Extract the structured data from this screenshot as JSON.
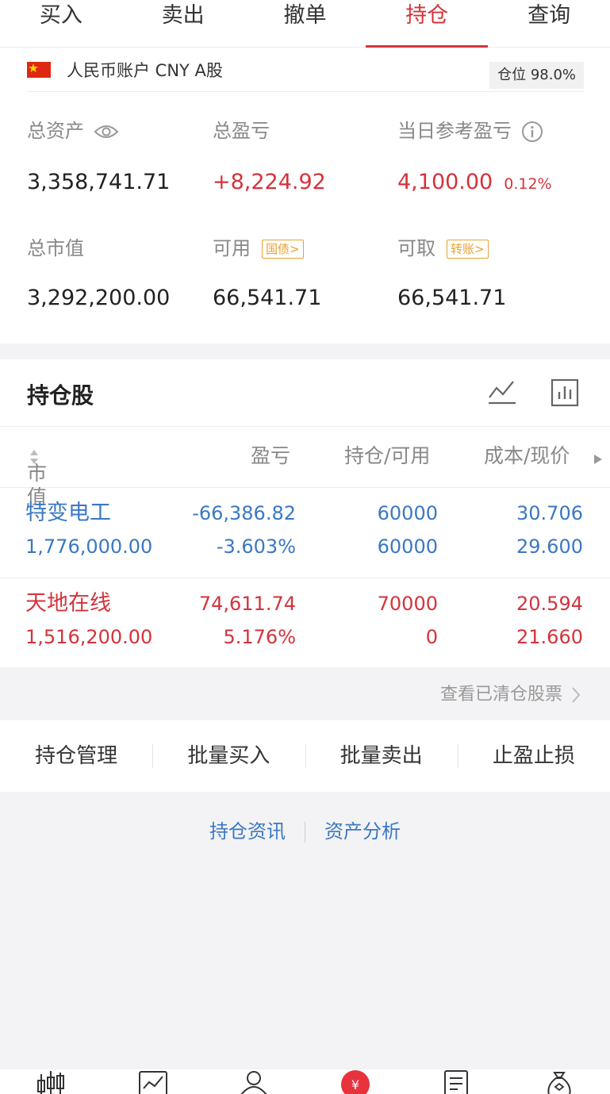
{
  "tabs": [
    "买入",
    "卖出",
    "撤单",
    "持仓",
    "查询"
  ],
  "active_tab": 3,
  "account": {
    "label": "人民币账户 CNY A股",
    "position_label": "仓位 98.0%"
  },
  "summary": {
    "total_assets_label": "总资产",
    "total_assets": "3,358,741.71",
    "total_pnl_label": "总盈亏",
    "total_pnl": "+8,224.92",
    "daily_pnl_label": "当日参考盈亏",
    "daily_pnl": "4,100.00",
    "daily_pnl_pct": "0.12%",
    "market_value_label": "总市值",
    "market_value": "3,292,200.00",
    "available_label": "可用",
    "available_tag": "国债>",
    "available": "66,541.71",
    "withdrawable_label": "可取",
    "withdrawable_tag": "转账>",
    "withdrawable": "66,541.71"
  },
  "holdings": {
    "title": "持仓股",
    "columns": [
      "市值",
      "盈亏",
      "持仓/可用",
      "成本/现价"
    ],
    "rows": [
      {
        "name": "特变电工",
        "market_value": "1,776,000.00",
        "pnl": "-66,386.82",
        "pnl_pct": "-3.603%",
        "position": "60000",
        "available": "60000",
        "cost": "30.706",
        "price": "29.600",
        "color": "#3a78c3"
      },
      {
        "name": "天地在线",
        "market_value": "1,516,200.00",
        "pnl": "74,611.74",
        "pnl_pct": "5.176%",
        "position": "70000",
        "available": "0",
        "cost": "20.594",
        "price": "21.660",
        "color": "#d4333a"
      }
    ]
  },
  "cleared_link": "查看已清仓股票",
  "actions": [
    "持仓管理",
    "批量买入",
    "批量卖出",
    "止盈止损"
  ],
  "links": [
    "持仓资讯",
    "资产分析"
  ],
  "nav_icons": [
    "candlestick-icon",
    "trend-chart-icon",
    "user-icon",
    "yuan-trade-icon",
    "document-icon",
    "money-bag-icon"
  ],
  "colors": {
    "red": "#d4333a",
    "blue": "#3a78c3",
    "tag": "#e7a230"
  }
}
